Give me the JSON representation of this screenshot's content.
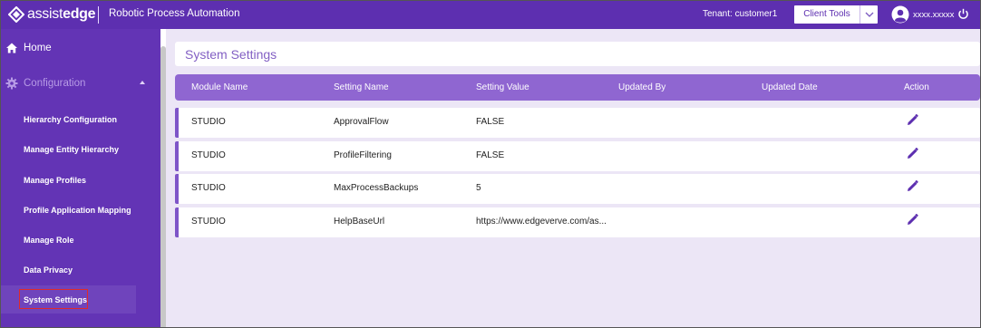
{
  "header": {
    "logo_prefix": "assist",
    "logo_bold": "edge",
    "app_title": "Robotic Process Automation",
    "tenant_text": "Tenant: customer1",
    "client_tools_label": "Client Tools",
    "username": "xxxx.xxxxx",
    "colors": {
      "brand": "#5d2fb0",
      "sidebar": "#6334b5",
      "accent": "#8f66d1"
    }
  },
  "sidebar": {
    "home_label": "Home",
    "config_label": "Configuration",
    "items": [
      {
        "label": "Hierarchy Configuration"
      },
      {
        "label": "Manage Entity Hierarchy"
      },
      {
        "label": "Manage Profiles"
      },
      {
        "label": "Profile Application Mapping"
      },
      {
        "label": "Manage Role"
      },
      {
        "label": "Data Privacy"
      },
      {
        "label": "System Settings",
        "active": true
      }
    ]
  },
  "main": {
    "title": "System Settings",
    "columns": [
      "Module Name",
      "Setting Name",
      "Setting Value",
      "Updated By",
      "Updated Date",
      "Action"
    ],
    "rows": [
      {
        "module": "STUDIO",
        "setting": "ApprovalFlow",
        "value": "FALSE",
        "updated_by": "",
        "updated_date": "",
        "action_icon": "edit-pencil-icon"
      },
      {
        "module": "STUDIO",
        "setting": "ProfileFiltering",
        "value": "FALSE",
        "updated_by": "",
        "updated_date": "",
        "action_icon": "edit-pencil-icon"
      },
      {
        "module": "STUDIO",
        "setting": "MaxProcessBackups",
        "value": "5",
        "updated_by": "",
        "updated_date": "",
        "action_icon": "edit-pencil-icon"
      },
      {
        "module": "STUDIO",
        "setting": "HelpBaseUrl",
        "value": "https://www.edgeverve.com/as...",
        "updated_by": "",
        "updated_date": "",
        "action_icon": "edit-pencil-icon"
      }
    ]
  }
}
